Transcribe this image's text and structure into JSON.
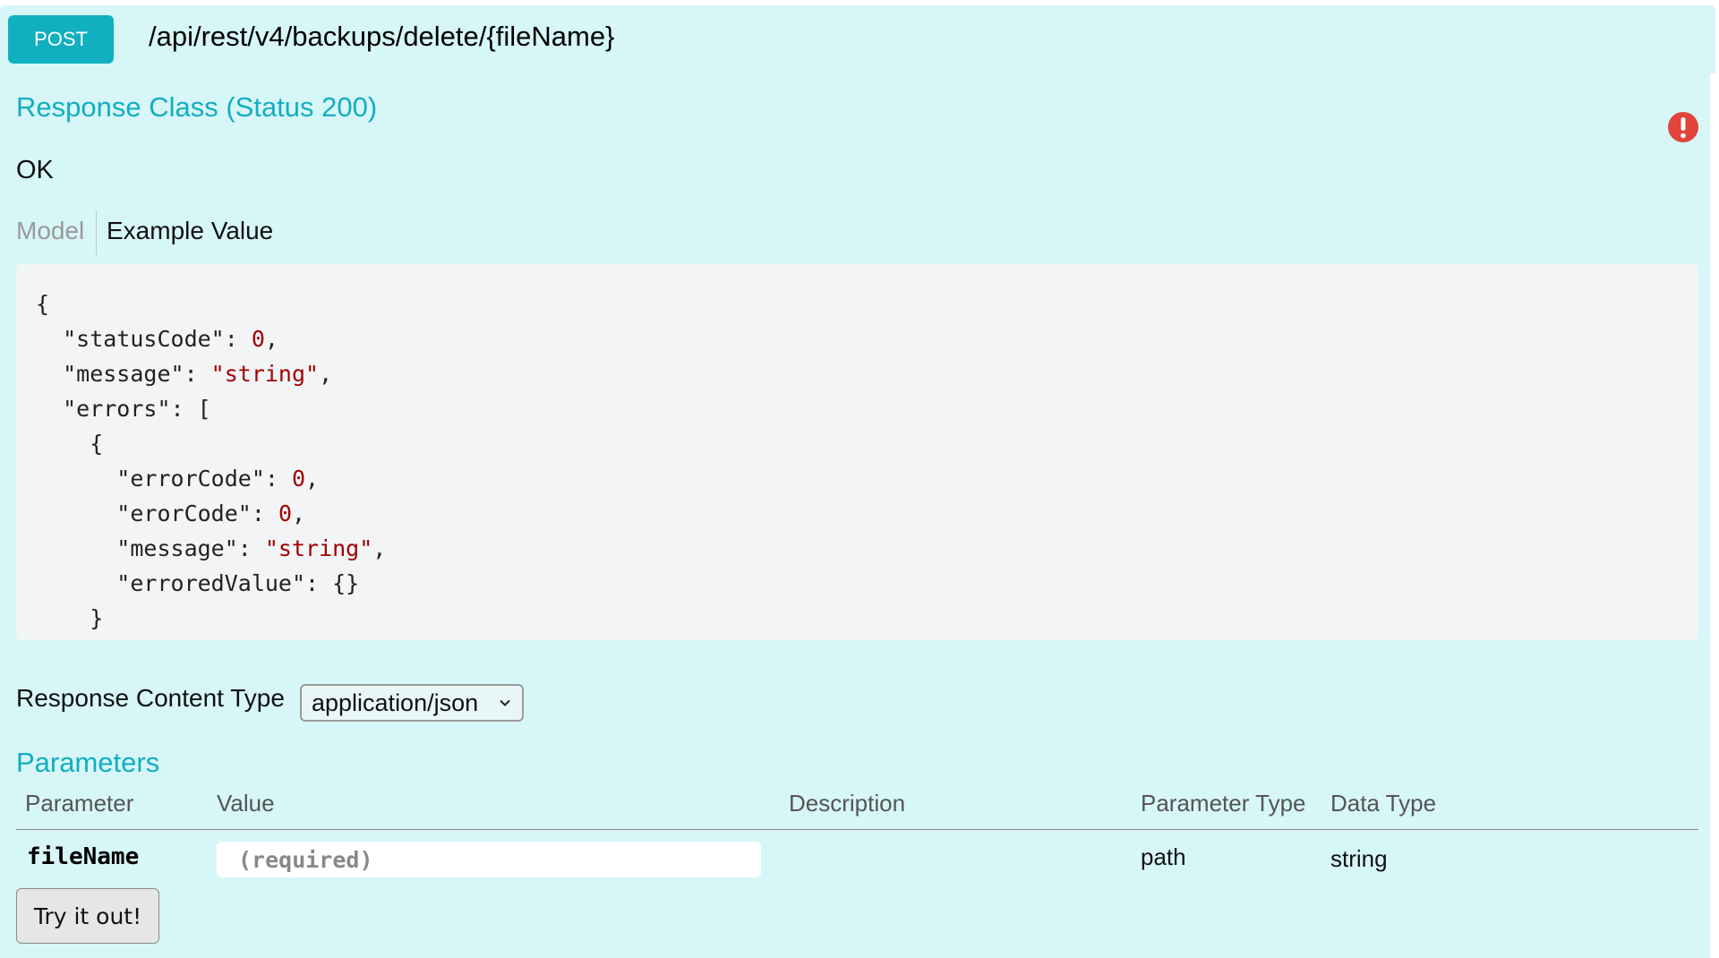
{
  "operation": {
    "method": "POST",
    "path": "/api/rest/v4/backups/delete/{fileName}"
  },
  "response_class": {
    "title": "Response Class (Status 200)",
    "status_text": "OK",
    "alert_icon": "exclamation-circle-icon",
    "alert_color": "#e0443a"
  },
  "model_tabs": {
    "model_label": "Model",
    "example_label": "Example Value"
  },
  "example_value": {
    "lines": [
      "{",
      "  \"statusCode\": 0,",
      "  \"message\": \"string\",",
      "  \"errors\": [",
      "    {",
      "      \"errorCode\": 0,",
      "      \"erorCode\": 0,",
      "      \"message\": \"string\",",
      "      \"erroredValue\": {}",
      "    }"
    ]
  },
  "response_content_type": {
    "label": "Response Content Type",
    "selected": "application/json"
  },
  "parameters": {
    "title": "Parameters",
    "columns": [
      "Parameter",
      "Value",
      "Description",
      "Parameter Type",
      "Data Type"
    ],
    "rows": [
      {
        "name": "fileName",
        "placeholder": "(required)",
        "description": "",
        "parameter_type": "path",
        "data_type": "string"
      }
    ]
  },
  "actions": {
    "try_label": "Try it out!"
  },
  "colors": {
    "panel_bg": "#d7f6f8",
    "accent": "#10b0c0",
    "code_value": "#a00000"
  }
}
